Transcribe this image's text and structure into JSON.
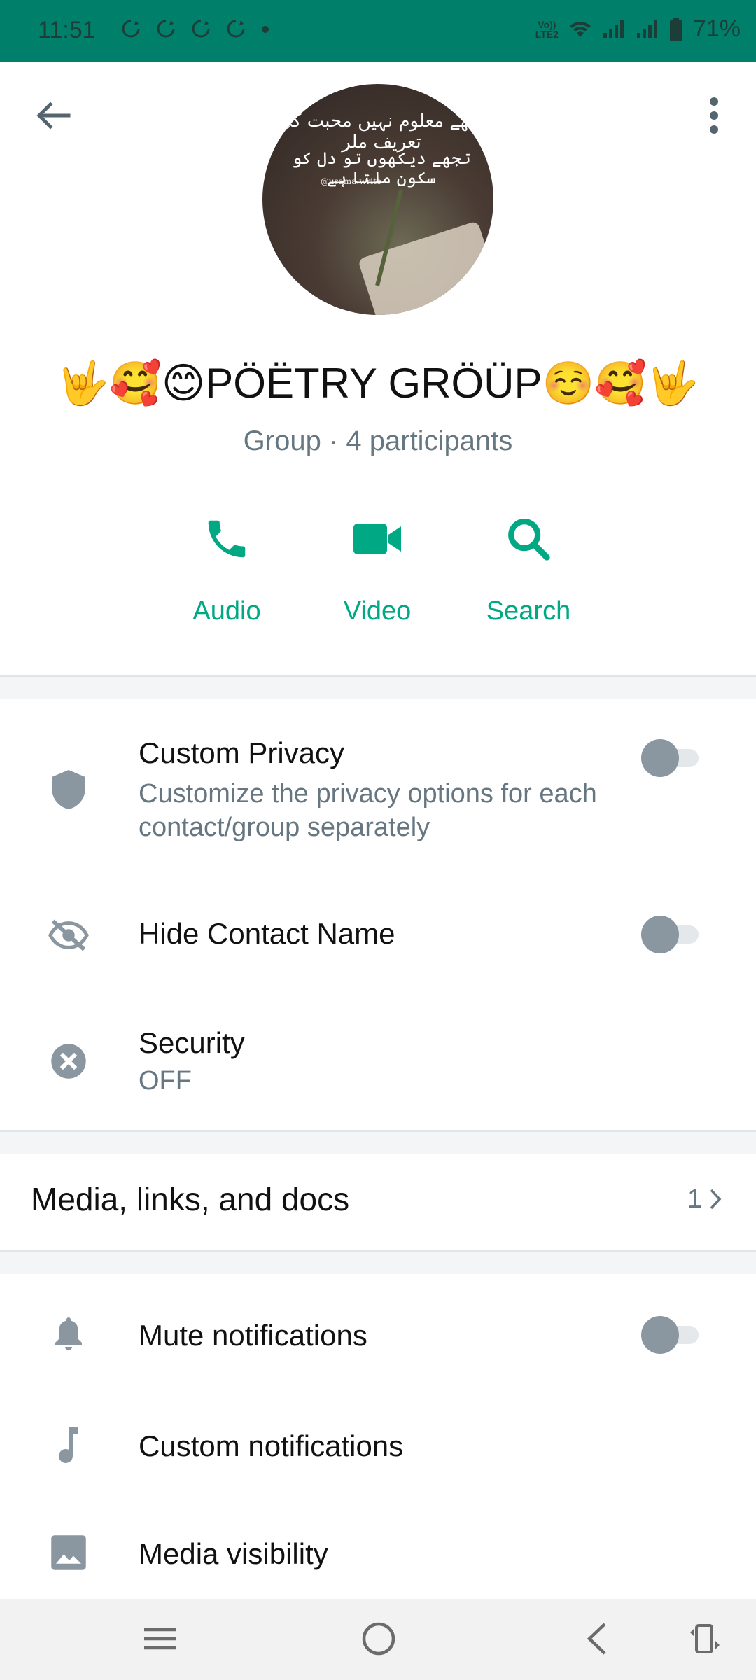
{
  "status_bar": {
    "time": "11:51",
    "volte": "Vo))",
    "lte": "LTE2",
    "battery": "71%"
  },
  "header": {
    "avatar_text_line1": "تجھے معلوم نہیں محبت کی تعریف ملر",
    "avatar_text_line2": "تجھے دیکھوں تو دل کو سکون ملتا ہے",
    "avatar_credit": "@usama.write"
  },
  "group": {
    "title": "🤟🥰😊PÖËTRY GRÖÜP☺️🥰🤟",
    "subtitle": "Group · 4 participants"
  },
  "actions": [
    {
      "label": "Audio",
      "icon": "phone-icon"
    },
    {
      "label": "Video",
      "icon": "video-camera-icon"
    },
    {
      "label": "Search",
      "icon": "search-icon"
    }
  ],
  "privacy": {
    "custom_privacy_title": "Custom Privacy",
    "custom_privacy_sub": "Customize the privacy options for each contact/group separately",
    "hide_contact_title": "Hide Contact Name",
    "security_title": "Security",
    "security_value": "OFF",
    "custom_privacy_on": false,
    "hide_contact_on": false
  },
  "media": {
    "label": "Media, links, and docs",
    "count": "1"
  },
  "notifications": {
    "mute_title": "Mute notifications",
    "custom_title": "Custom notifications",
    "visibility_title": "Media visibility",
    "mute_on": false
  },
  "colors": {
    "status_bar": "#00806b",
    "accent": "#00a884",
    "secondary_text": "#667781",
    "icon_grey": "#8a96a0"
  }
}
